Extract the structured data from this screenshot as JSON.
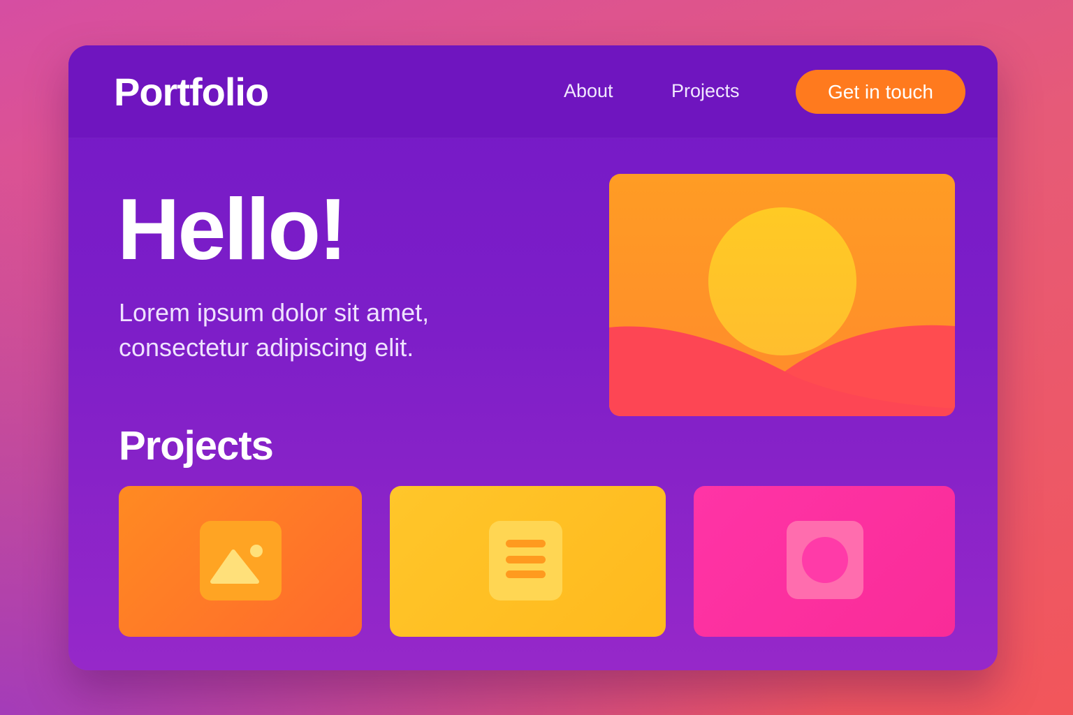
{
  "nav": {
    "logo": "Portfolio",
    "links": [
      {
        "label": "About"
      },
      {
        "label": "Projects"
      }
    ],
    "cta_label": "Get in touch"
  },
  "hero": {
    "title": "Hello!",
    "subtitle": "Lorem ipsum dolor sit amet, consectetur adipiscing elit.",
    "image": "sunset-illustration"
  },
  "projects": {
    "title": "Projects",
    "cards": [
      {
        "icon": "image-icon",
        "color": "#ff7a24"
      },
      {
        "icon": "document-icon",
        "color": "#ffc024"
      },
      {
        "icon": "circle-icon",
        "color": "#fc30a0"
      }
    ]
  },
  "colors": {
    "accent": "#ff7a1e",
    "window": "#7419c6",
    "nav_bar": "#6f15bf"
  }
}
